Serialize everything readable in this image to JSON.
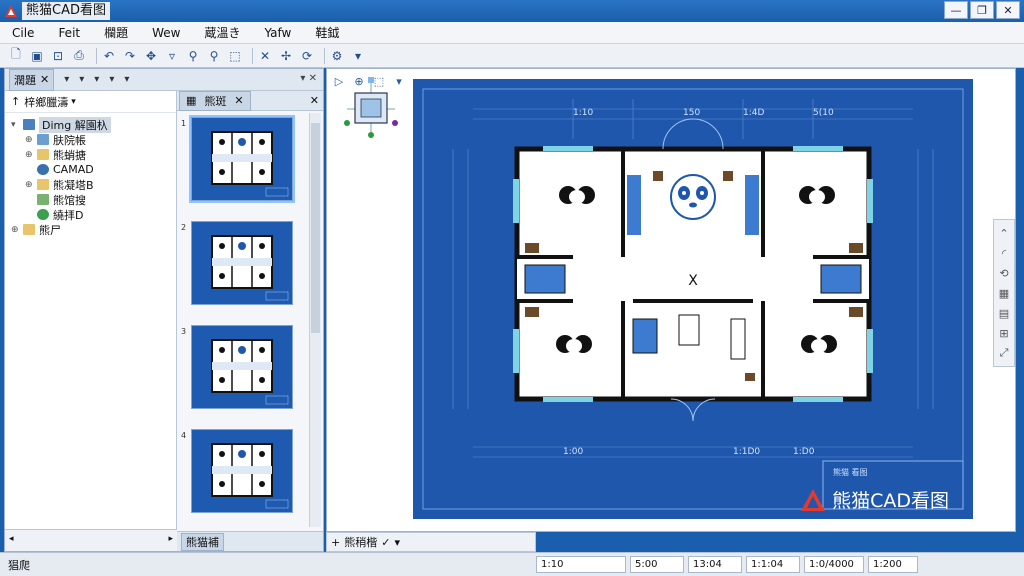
{
  "window": {
    "title": "熊猫CAD看图",
    "minimize": "—",
    "maximize": "❐",
    "close": "✕"
  },
  "menu": [
    "Cile",
    "Feit",
    "欄題",
    "Wew",
    "蔵溫き",
    "Yafw",
    "鞋鉞"
  ],
  "toolbar_icons": [
    "new-icon",
    "open-icon",
    "lock-icon",
    "print-icon",
    "undo-icon",
    "redo-icon",
    "pan-icon",
    "select-icon",
    "zoom-in-icon",
    "zoom-out-icon",
    "zoom-window-icon",
    "measure-icon",
    "move-icon",
    "rotate-icon",
    "settings-icon"
  ],
  "left_panel": {
    "tab_label": "濶題",
    "tree_header": "梓鄉臘濤",
    "tree": [
      {
        "label": "Dimg 解園杁",
        "icon": "drawing-icon",
        "level": 0,
        "toggle": "▾",
        "root": true
      },
      {
        "label": "肤院帳",
        "icon": "layer-icon",
        "level": 1,
        "toggle": "⊕"
      },
      {
        "label": "熊蛸搪",
        "icon": "folder-icon",
        "level": 1,
        "toggle": "⊕"
      },
      {
        "label": "CAMAD",
        "icon": "cad-icon",
        "level": 1,
        "toggle": ""
      },
      {
        "label": "熊凝塔B",
        "icon": "folder-icon",
        "level": 1,
        "toggle": "⊕"
      },
      {
        "label": "熊馆搜",
        "icon": "block-icon",
        "level": 1,
        "toggle": ""
      },
      {
        "label": "繞拝D",
        "icon": "globe-icon",
        "level": 1,
        "toggle": ""
      },
      {
        "label": "熊尸",
        "icon": "folder-icon",
        "level": 0,
        "toggle": "⊕"
      }
    ],
    "bottom_label": "猖爬"
  },
  "thumbs_panel": {
    "tab_label": "熊斑",
    "bottom_label": "熊猫補",
    "pages": [
      "1",
      "2",
      "3",
      "4"
    ]
  },
  "canvas": {
    "tool_labels": [
      "▷",
      "⊕",
      "⬚"
    ],
    "room_label": "X",
    "dimensions_top": [
      "1:10",
      "150",
      "1:4D",
      "5(10"
    ],
    "dimensions_bottom": [
      "1:00",
      "1:1D0",
      "1:D0"
    ],
    "title_block": "熊猫 看图",
    "watermark": "熊猫CAD看图"
  },
  "layout_strip": {
    "label": "熊稍楷",
    "icons": [
      "✓",
      "✓"
    ]
  },
  "status": {
    "left": "猖爬",
    "fields": [
      "1:10",
      "5:00",
      "13:04",
      "1:1:04",
      "1:0/4000",
      "1:200"
    ]
  }
}
